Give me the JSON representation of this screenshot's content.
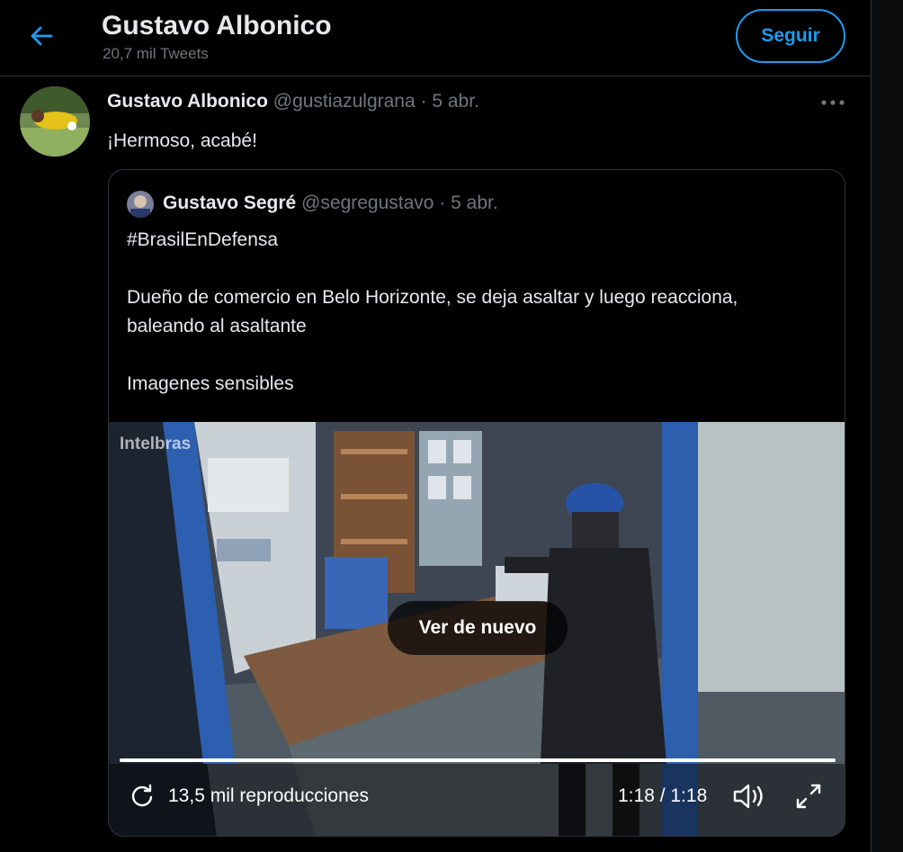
{
  "header": {
    "name": "Gustavo Albonico",
    "tweet_count": "20,7 mil Tweets",
    "follow_label": "Seguir"
  },
  "tweet": {
    "author_name": "Gustavo Albonico",
    "handle": "@gustiazulgrana",
    "separator": " · ",
    "date": "5 abr.",
    "text": "¡Hermoso, acabé!"
  },
  "quote": {
    "author_name": "Gustavo Segré",
    "handle": "@segregustavo",
    "separator": " · ",
    "date": "5 abr.",
    "lines": [
      "#BrasilEnDefensa",
      "",
      "Dueño de comercio en Belo Horizonte, se deja asaltar y luego reacciona,",
      "baleando al asaltante",
      "",
      "Imagenes sensibles"
    ]
  },
  "video": {
    "watermark": "Intelbras",
    "replay_label": "Ver de nuevo",
    "views": "13,5 mil reproducciones",
    "time": "1:18 / 1:18",
    "progress": 1.0
  },
  "icons": {
    "back": "arrow-left-icon",
    "more": "more-horizontal-icon",
    "views": "replay-views-icon",
    "volume": "volume-icon",
    "fullscreen": "fullscreen-icon"
  },
  "colors": {
    "background": "#000000",
    "accent": "#1d9bf0",
    "text_primary": "#e7e9ea",
    "text_secondary": "#6e767d",
    "border": "#2f3336"
  }
}
